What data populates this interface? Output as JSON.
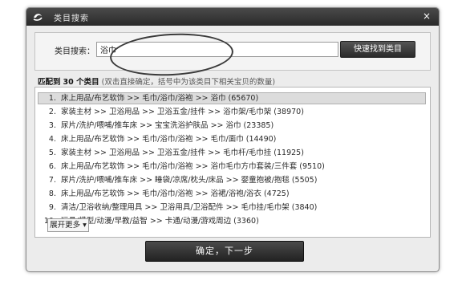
{
  "window": {
    "title": "类目搜索",
    "close_label": "×"
  },
  "search": {
    "label": "类目搜索：",
    "value": "浴巾",
    "button_label": "快速找到类目"
  },
  "summary": {
    "prefix": "匹配到",
    "count_text": "30 个类目",
    "hint": "(双击直接确定，括号中为该类目下相关宝贝的数量)"
  },
  "results": [
    {
      "num": "1.",
      "text": "床上用品/布艺软饰 >> 毛巾/浴巾/浴袍 >> 浴巾 (65670)",
      "selected": true
    },
    {
      "num": "2.",
      "text": "家装主材 >> 卫浴用品 >> 卫浴五金/挂件 >> 浴巾架/毛巾架 (38970)"
    },
    {
      "num": "3.",
      "text": "尿片/洗护/喂哺/推车床 >> 宝宝洗浴护肤品 >> 浴巾 (23385)"
    },
    {
      "num": "4.",
      "text": "床上用品/布艺软饰 >> 毛巾/浴巾/浴袍 >> 毛巾/面巾 (14490)"
    },
    {
      "num": "5.",
      "text": "家装主材 >> 卫浴用品 >> 卫浴五金/挂件 >> 毛巾杆/毛巾挂 (11925)"
    },
    {
      "num": "6.",
      "text": "床上用品/布艺软饰 >> 毛巾/浴巾/浴袍 >> 浴巾毛巾方巾套装/三件套 (9510)"
    },
    {
      "num": "7.",
      "text": "尿片/洗护/喂哺/推车床 >> 睡袋/凉席/枕头/床品 >> 婴童抱被/抱毯 (5505)"
    },
    {
      "num": "8.",
      "text": "床上用品/布艺软饰 >> 毛巾/浴巾/浴袍 >> 浴裙/浴袍/浴衣 (4725)"
    },
    {
      "num": "9.",
      "text": "清洁/卫浴收纳/整理用具 >> 卫浴用具/卫浴配件 >> 毛巾挂/毛巾架 (3840)"
    },
    {
      "num": "10.",
      "text": "玩具/模型/动漫/早教/益智 >> 卡通/动漫/游戏周边 (3360)"
    }
  ],
  "expand_label": "展开更多 ▾",
  "confirm_label": "确定，下一步"
}
